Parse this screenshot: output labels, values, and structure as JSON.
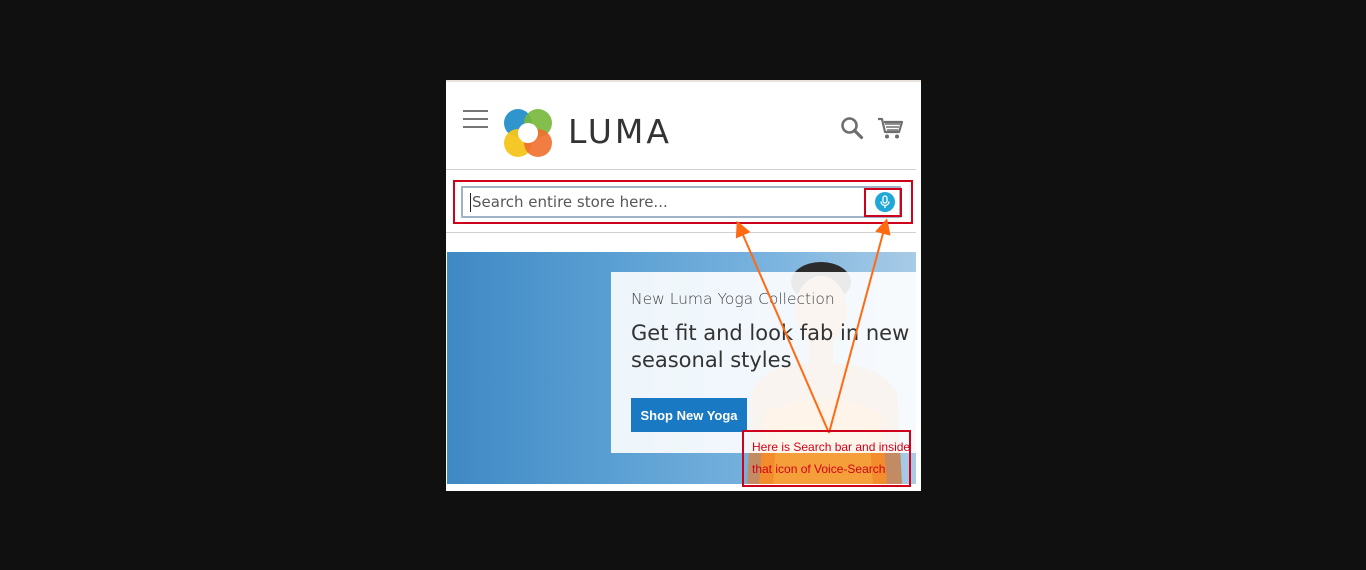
{
  "header": {
    "logo_text": "LUMA"
  },
  "search": {
    "placeholder": "Search entire store here...",
    "value": ""
  },
  "hero": {
    "kicker": "New Luma Yoga Collection",
    "title": "Get fit and look fab in new seasonal styles",
    "cta_label": "Shop New Yoga"
  },
  "annotation": {
    "note": "Here is Search bar and inside that icon of Voice-Search"
  },
  "colors": {
    "annotation_red": "#d0021b",
    "arrow_orange": "#ff6a13",
    "cta_blue": "#1979c3",
    "voice_icon": "#1fa7d8"
  },
  "icons": {
    "menu": "hamburger-icon",
    "search": "search-icon",
    "cart": "cart-icon",
    "voice": "microphone-icon"
  }
}
